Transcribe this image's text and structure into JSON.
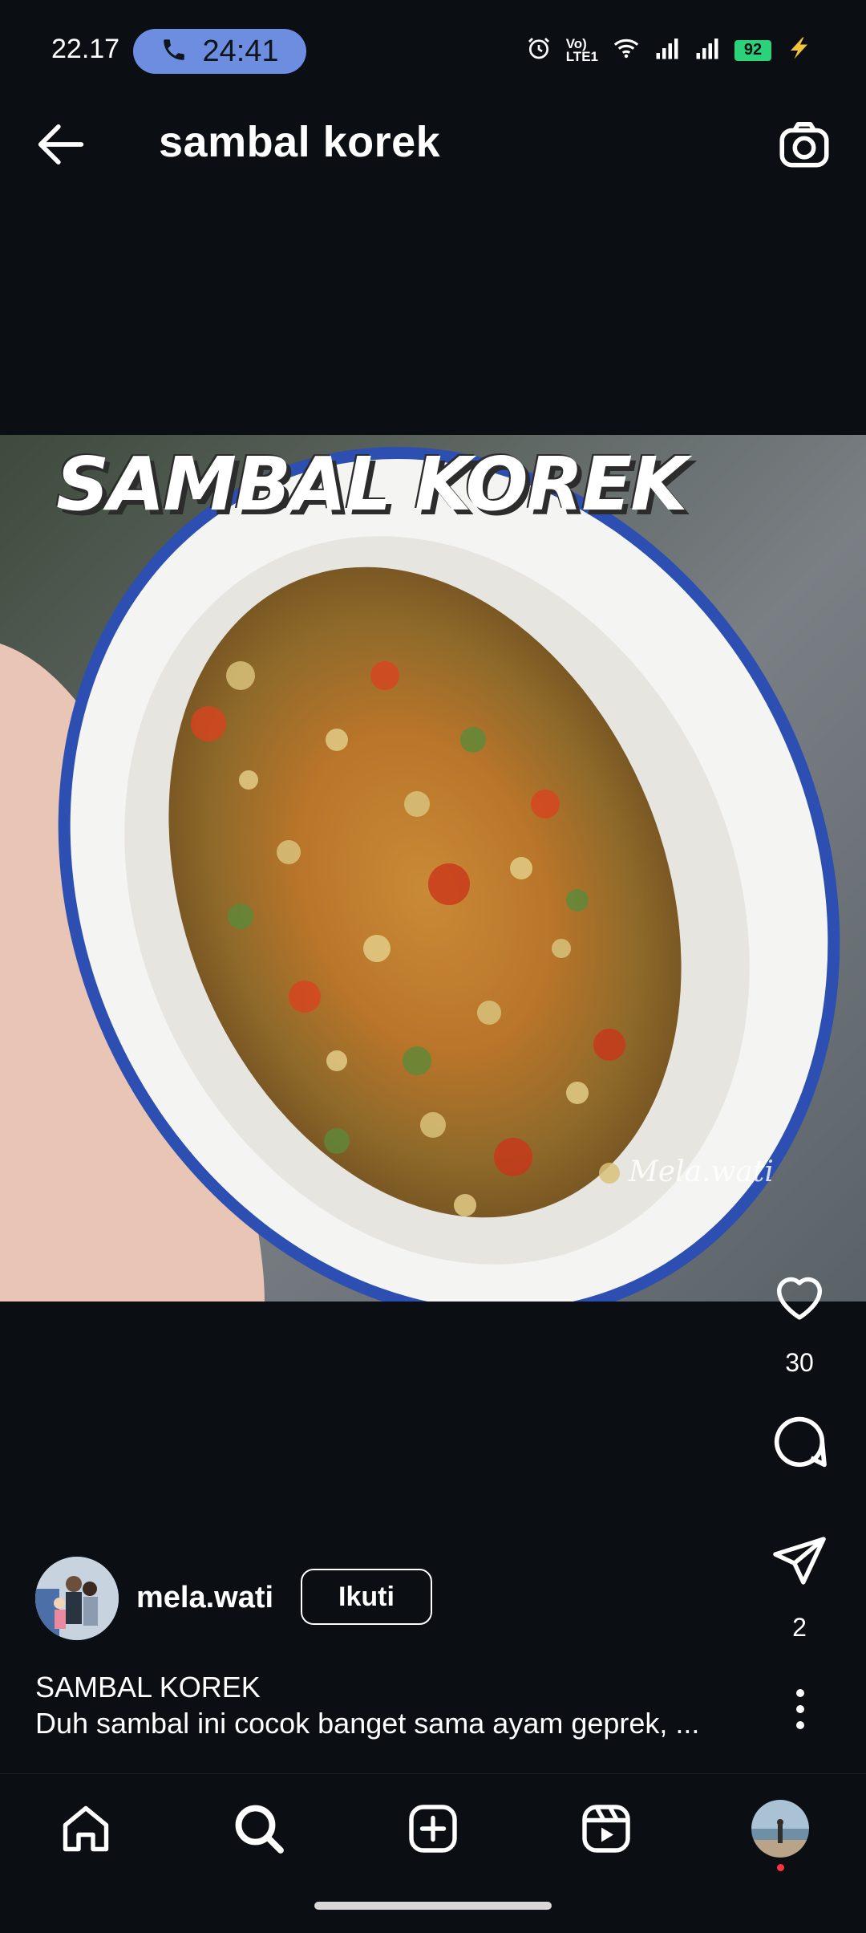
{
  "status_bar": {
    "time": "22.17",
    "call_timer": "24:41",
    "network_label_top": "Vo)",
    "network_label_bottom": "LTE1",
    "battery_level": "92",
    "icons": [
      "phone-icon",
      "alarm-icon",
      "wifi-icon",
      "signal-icon",
      "signal-icon",
      "battery-icon",
      "charging-icon"
    ]
  },
  "header": {
    "title": "sambal korek",
    "back_icon": "arrow-left-icon",
    "camera_icon": "camera-icon"
  },
  "post": {
    "image_overlay_title": "SAMBAL KOREK",
    "watermark": "Mela.wati",
    "likes": "30",
    "shares": "2",
    "author": {
      "username": "mela.wati",
      "follow_label": "Ikuti"
    },
    "caption_title": "SAMBAL KOREK",
    "caption_text": "Duh sambal ini cocok banget sama ayam geprek, ..."
  },
  "bottom_nav": {
    "items": [
      "home-icon",
      "search-icon",
      "add-post-icon",
      "reels-icon",
      "profile-avatar"
    ]
  },
  "colors": {
    "background": "#0b0f14",
    "call_pill": "#6d8ee0",
    "battery": "#2bd27a",
    "notification_dot": "#ff3040"
  }
}
